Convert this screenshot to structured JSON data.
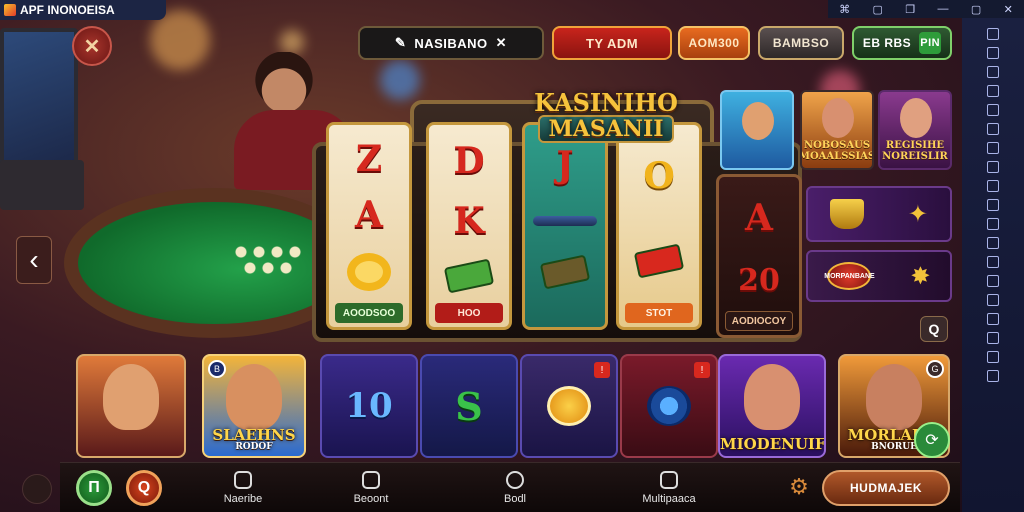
{
  "app_tag": {
    "label": "APF INONOEISA"
  },
  "system_bar": {
    "icons": [
      "puzzle-icon",
      "window-icon",
      "copy-icon",
      "minimize-icon",
      "maximize-icon",
      "close-icon"
    ],
    "glyphs": [
      "⌘",
      "▢",
      "❐",
      "—",
      "▢",
      "✕"
    ]
  },
  "top": {
    "close_glyph": "✕",
    "search_label": "NASIBANO",
    "pill_red": "TY ADM",
    "pill_orange": "AOM300",
    "pill_grey": "BAMBSO",
    "pill_green": "EB RBS",
    "pill_green_badge": "PIN"
  },
  "slot": {
    "title_line1": "KASINIHO",
    "title_line2": "MASANII",
    "reels": [
      {
        "symbols": [
          "Z",
          "A"
        ],
        "bottom": "ring",
        "label": "AOODSOO"
      },
      {
        "symbols": [
          "D",
          "K"
        ],
        "bottom": "card",
        "label": "HOO"
      },
      {
        "symbols": [
          "J"
        ],
        "bottom": "bar",
        "label": ""
      },
      {
        "symbols": [
          "O"
        ],
        "bottom": "card",
        "label": "STOT"
      }
    ],
    "right_reel": {
      "symbols": [
        "A",
        "20"
      ],
      "label": "AODIOCOY"
    }
  },
  "thumbs": [
    {
      "id": "t-a",
      "caption": ""
    },
    {
      "id": "t-b",
      "caption": "NOBOSAUS\nMOAALSSIAS"
    },
    {
      "id": "t-c",
      "caption": "REGISIHE\nNOREISLIR"
    }
  ],
  "thumb_wide": [
    {
      "id": "t-d",
      "caption": ""
    },
    {
      "id": "t-e",
      "caption": "MORPANBANE"
    }
  ],
  "games": [
    {
      "class": "gc-1",
      "caption": "",
      "sub": ""
    },
    {
      "class": "gc-2",
      "caption": "SLAEHNS",
      "sub": "RODOF"
    },
    {
      "class": "gc-3",
      "caption": "10",
      "sub": ""
    },
    {
      "class": "gc-4",
      "caption": "S",
      "sub": ""
    },
    {
      "class": "gc-5",
      "caption": "",
      "sub": ""
    },
    {
      "class": "gc-6",
      "caption": "",
      "sub": ""
    },
    {
      "class": "gc-7",
      "caption": "MIODENUIF",
      "sub": ""
    },
    {
      "class": "gc-8",
      "caption": "MORLALIS",
      "sub": "BNORUE"
    }
  ],
  "nav": {
    "back_glyph": "‹",
    "round_green": "П",
    "round_red": "Q",
    "items": [
      {
        "label": "Naeribe",
        "icon": "puzzle-icon"
      },
      {
        "label": "Beoont",
        "icon": "shield-icon"
      },
      {
        "label": "Bodl",
        "icon": "clock-icon"
      },
      {
        "label": "Multipaaca",
        "icon": "window-icon"
      }
    ],
    "cta_label": "HUDMAJEK",
    "q_glyph": "Q"
  }
}
